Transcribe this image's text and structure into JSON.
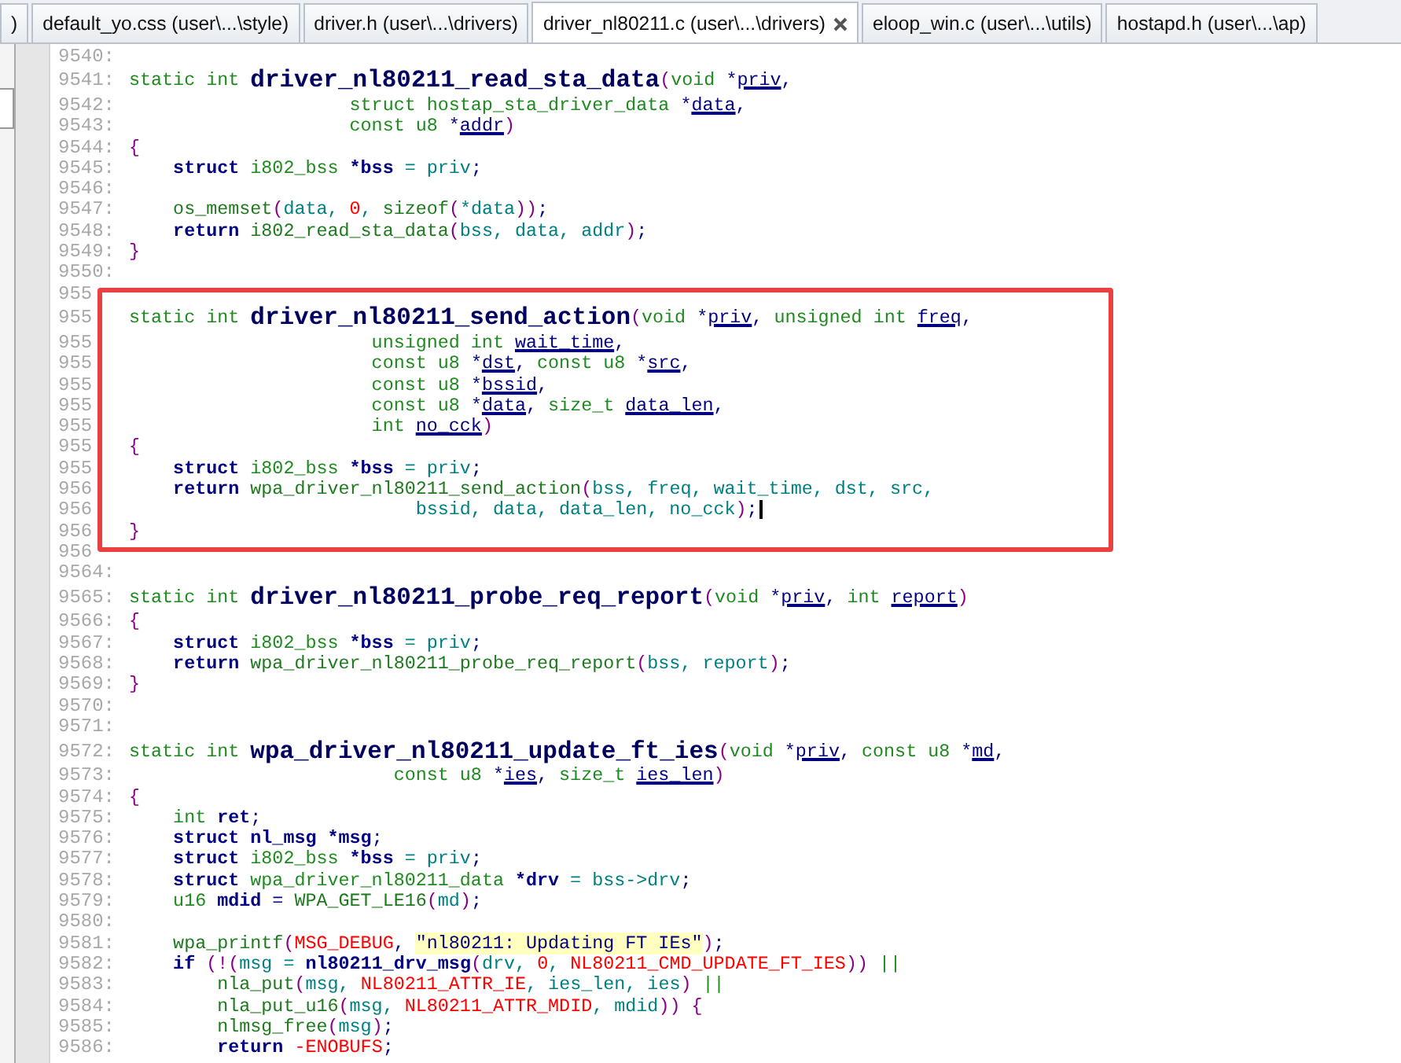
{
  "tabs": [
    {
      "label": ")",
      "selected": false
    },
    {
      "label": "default_yo.css (user\\...\\style)",
      "selected": false
    },
    {
      "label": "driver.h (user\\...\\drivers)",
      "selected": false
    },
    {
      "label": "driver_nl80211.c (user\\...\\drivers)",
      "selected": true
    },
    {
      "label": "eloop_win.c (user\\...\\utils)",
      "selected": false
    },
    {
      "label": "hostapd.h (user\\...\\ap)",
      "selected": false
    }
  ],
  "editor": {
    "lines": [
      {
        "number": "9540:",
        "cursor": false
      },
      {
        "number": "9541:",
        "cursor": false,
        "tokens": [
          {
            "kind": "type",
            "text": "static int "
          },
          {
            "kind": "funcname",
            "text": "driver_nl80211_read_sta_data"
          },
          {
            "kind": "paren",
            "text": "("
          },
          {
            "kind": "type",
            "text": "void "
          },
          {
            "kind": "punct",
            "text": "*"
          },
          {
            "kind": "param",
            "text": "priv"
          },
          {
            "kind": "punct",
            "text": ","
          }
        ]
      },
      {
        "number": "9542:",
        "cursor": false,
        "tokens": [
          {
            "kind": "type",
            "text": "                    struct hostap_sta_driver_data "
          },
          {
            "kind": "punct",
            "text": "*"
          },
          {
            "kind": "param",
            "text": "data"
          },
          {
            "kind": "punct",
            "text": ","
          }
        ]
      },
      {
        "number": "9543:",
        "cursor": false,
        "tokens": [
          {
            "kind": "type",
            "text": "                    const u8 "
          },
          {
            "kind": "punct",
            "text": "*"
          },
          {
            "kind": "param",
            "text": "addr"
          },
          {
            "kind": "paren",
            "text": ")"
          }
        ]
      },
      {
        "number": "9544:",
        "cursor": false,
        "tokens": [
          {
            "kind": "paren",
            "text": "{"
          }
        ]
      },
      {
        "number": "9545:",
        "cursor": false,
        "tokens": [
          {
            "kind": "keyword",
            "text": "    struct "
          },
          {
            "kind": "type",
            "text": "i802_bss "
          },
          {
            "kind": "keyword",
            "text": "*bss"
          },
          {
            "kind": "ident",
            "text": " = priv"
          },
          {
            "kind": "punct",
            "text": ";"
          }
        ]
      },
      {
        "number": "9546:",
        "cursor": false
      },
      {
        "number": "9547:",
        "cursor": false,
        "tokens": [
          {
            "kind": "call",
            "text": "    os_memset"
          },
          {
            "kind": "paren",
            "text": "("
          },
          {
            "kind": "ident",
            "text": "data, "
          },
          {
            "kind": "literal",
            "text": "0"
          },
          {
            "kind": "ident",
            "text": ", "
          },
          {
            "kind": "call",
            "text": "sizeof"
          },
          {
            "kind": "paren",
            "text": "("
          },
          {
            "kind": "ident",
            "text": "*data"
          },
          {
            "kind": "paren",
            "text": "))"
          },
          {
            "kind": "punct",
            "text": ";"
          }
        ]
      },
      {
        "number": "9548:",
        "cursor": false,
        "tokens": [
          {
            "kind": "keyword",
            "text": "    return "
          },
          {
            "kind": "call",
            "text": "i802_read_sta_data"
          },
          {
            "kind": "paren",
            "text": "("
          },
          {
            "kind": "ident",
            "text": "bss, data, addr"
          },
          {
            "kind": "paren",
            "text": ")"
          },
          {
            "kind": "punct",
            "text": ";"
          }
        ]
      },
      {
        "number": "9549:",
        "cursor": false,
        "tokens": [
          {
            "kind": "paren",
            "text": "}"
          }
        ]
      },
      {
        "number": "9550:",
        "cursor": false
      },
      {
        "number": "955",
        "cursor": false
      },
      {
        "number": "955",
        "cursor": false,
        "tokens": [
          {
            "kind": "type",
            "text": "static int "
          },
          {
            "kind": "funcname",
            "text": "driver_nl80211_send_action"
          },
          {
            "kind": "paren",
            "text": "("
          },
          {
            "kind": "type",
            "text": "void "
          },
          {
            "kind": "punct",
            "text": "*"
          },
          {
            "kind": "param",
            "text": "priv"
          },
          {
            "kind": "punct",
            "text": ", "
          },
          {
            "kind": "type",
            "text": "unsigned int "
          },
          {
            "kind": "param",
            "text": "freq"
          },
          {
            "kind": "punct",
            "text": ","
          }
        ]
      },
      {
        "number": "955",
        "cursor": false,
        "tokens": [
          {
            "kind": "type",
            "text": "                      unsigned int "
          },
          {
            "kind": "param",
            "text": "wait_time"
          },
          {
            "kind": "punct",
            "text": ","
          }
        ]
      },
      {
        "number": "955",
        "cursor": false,
        "tokens": [
          {
            "kind": "type",
            "text": "                      const u8 "
          },
          {
            "kind": "punct",
            "text": "*"
          },
          {
            "kind": "param",
            "text": "dst"
          },
          {
            "kind": "punct",
            "text": ", "
          },
          {
            "kind": "type",
            "text": "const u8 "
          },
          {
            "kind": "punct",
            "text": "*"
          },
          {
            "kind": "param",
            "text": "src"
          },
          {
            "kind": "punct",
            "text": ","
          }
        ]
      },
      {
        "number": "955",
        "cursor": false,
        "tokens": [
          {
            "kind": "type",
            "text": "                      const u8 "
          },
          {
            "kind": "punct",
            "text": "*"
          },
          {
            "kind": "param",
            "text": "bssid"
          },
          {
            "kind": "punct",
            "text": ","
          }
        ]
      },
      {
        "number": "955",
        "cursor": false,
        "tokens": [
          {
            "kind": "type",
            "text": "                      const u8 "
          },
          {
            "kind": "punct",
            "text": "*"
          },
          {
            "kind": "param",
            "text": "data"
          },
          {
            "kind": "punct",
            "text": ", "
          },
          {
            "kind": "type",
            "text": "size_t "
          },
          {
            "kind": "param",
            "text": "data_len"
          },
          {
            "kind": "punct",
            "text": ","
          }
        ]
      },
      {
        "number": "955",
        "cursor": false,
        "tokens": [
          {
            "kind": "type",
            "text": "                      int "
          },
          {
            "kind": "param",
            "text": "no_cck"
          },
          {
            "kind": "paren",
            "text": ")"
          }
        ]
      },
      {
        "number": "955",
        "cursor": false,
        "tokens": [
          {
            "kind": "paren",
            "text": "{"
          }
        ]
      },
      {
        "number": "955",
        "cursor": false,
        "tokens": [
          {
            "kind": "keyword",
            "text": "    struct "
          },
          {
            "kind": "type",
            "text": "i802_bss "
          },
          {
            "kind": "keyword",
            "text": "*bss"
          },
          {
            "kind": "ident",
            "text": " = priv"
          },
          {
            "kind": "punct",
            "text": ";"
          }
        ]
      },
      {
        "number": "956",
        "cursor": false,
        "tokens": [
          {
            "kind": "keyword",
            "text": "    return "
          },
          {
            "kind": "call",
            "text": "wpa_driver_nl80211_send_action"
          },
          {
            "kind": "paren",
            "text": "("
          },
          {
            "kind": "ident",
            "text": "bss, freq, wait_time, dst, src,"
          }
        ]
      },
      {
        "number": "956",
        "cursor": true,
        "tokens": [
          {
            "kind": "ident",
            "text": "                          bssid, data, data_len, no_cck"
          },
          {
            "kind": "paren",
            "text": ")"
          },
          {
            "kind": "punct",
            "text": ";"
          }
        ]
      },
      {
        "number": "956",
        "cursor": false,
        "tokens": [
          {
            "kind": "paren",
            "text": "}"
          }
        ]
      },
      {
        "number": "956",
        "cursor": false
      },
      {
        "number": "9564:",
        "cursor": false
      },
      {
        "number": "9565:",
        "cursor": false,
        "tokens": [
          {
            "kind": "type",
            "text": "static int "
          },
          {
            "kind": "funcname",
            "text": "driver_nl80211_probe_req_report"
          },
          {
            "kind": "paren",
            "text": "("
          },
          {
            "kind": "type",
            "text": "void "
          },
          {
            "kind": "punct",
            "text": "*"
          },
          {
            "kind": "param",
            "text": "priv"
          },
          {
            "kind": "punct",
            "text": ", "
          },
          {
            "kind": "type",
            "text": "int "
          },
          {
            "kind": "param",
            "text": "report"
          },
          {
            "kind": "paren",
            "text": ")"
          }
        ]
      },
      {
        "number": "9566:",
        "cursor": false,
        "tokens": [
          {
            "kind": "paren",
            "text": "{"
          }
        ]
      },
      {
        "number": "9567:",
        "cursor": false,
        "tokens": [
          {
            "kind": "keyword",
            "text": "    struct "
          },
          {
            "kind": "type",
            "text": "i802_bss "
          },
          {
            "kind": "keyword",
            "text": "*bss"
          },
          {
            "kind": "ident",
            "text": " = priv"
          },
          {
            "kind": "punct",
            "text": ";"
          }
        ]
      },
      {
        "number": "9568:",
        "cursor": false,
        "tokens": [
          {
            "kind": "keyword",
            "text": "    return "
          },
          {
            "kind": "call",
            "text": "wpa_driver_nl80211_probe_req_report"
          },
          {
            "kind": "paren",
            "text": "("
          },
          {
            "kind": "ident",
            "text": "bss, report"
          },
          {
            "kind": "paren",
            "text": ")"
          },
          {
            "kind": "punct",
            "text": ";"
          }
        ]
      },
      {
        "number": "9569:",
        "cursor": false,
        "tokens": [
          {
            "kind": "paren",
            "text": "}"
          }
        ]
      },
      {
        "number": "9570:",
        "cursor": false
      },
      {
        "number": "9571:",
        "cursor": false
      },
      {
        "number": "9572:",
        "cursor": false,
        "tokens": [
          {
            "kind": "type",
            "text": "static int "
          },
          {
            "kind": "funcname",
            "text": "wpa_driver_nl80211_update_ft_ies"
          },
          {
            "kind": "paren",
            "text": "("
          },
          {
            "kind": "type",
            "text": "void "
          },
          {
            "kind": "punct",
            "text": "*"
          },
          {
            "kind": "param",
            "text": "priv"
          },
          {
            "kind": "punct",
            "text": ", "
          },
          {
            "kind": "type",
            "text": "const u8 "
          },
          {
            "kind": "punct",
            "text": "*"
          },
          {
            "kind": "param",
            "text": "md"
          },
          {
            "kind": "punct",
            "text": ","
          }
        ]
      },
      {
        "number": "9573:",
        "cursor": false,
        "tokens": [
          {
            "kind": "type",
            "text": "                        const u8 "
          },
          {
            "kind": "punct",
            "text": "*"
          },
          {
            "kind": "param",
            "text": "ies"
          },
          {
            "kind": "punct",
            "text": ", "
          },
          {
            "kind": "type",
            "text": "size_t "
          },
          {
            "kind": "param",
            "text": "ies_len"
          },
          {
            "kind": "paren",
            "text": ")"
          }
        ]
      },
      {
        "number": "9574:",
        "cursor": false,
        "tokens": [
          {
            "kind": "paren",
            "text": "{"
          }
        ]
      },
      {
        "number": "9575:",
        "cursor": false,
        "tokens": [
          {
            "kind": "type",
            "text": "    int "
          },
          {
            "kind": "keyword",
            "text": "ret"
          },
          {
            "kind": "punct",
            "text": ";"
          }
        ]
      },
      {
        "number": "9576:",
        "cursor": false,
        "tokens": [
          {
            "kind": "keyword",
            "text": "    struct nl_msg *msg"
          },
          {
            "kind": "punct",
            "text": ";"
          }
        ]
      },
      {
        "number": "9577:",
        "cursor": false,
        "tokens": [
          {
            "kind": "keyword",
            "text": "    struct "
          },
          {
            "kind": "type",
            "text": "i802_bss "
          },
          {
            "kind": "keyword",
            "text": "*bss"
          },
          {
            "kind": "ident",
            "text": " = priv"
          },
          {
            "kind": "punct",
            "text": ";"
          }
        ]
      },
      {
        "number": "9578:",
        "cursor": false,
        "tokens": [
          {
            "kind": "keyword",
            "text": "    struct "
          },
          {
            "kind": "type",
            "text": "wpa_driver_nl80211_data "
          },
          {
            "kind": "keyword",
            "text": "*drv"
          },
          {
            "kind": "ident",
            "text": " = bss->drv"
          },
          {
            "kind": "punct",
            "text": ";"
          }
        ]
      },
      {
        "number": "9579:",
        "cursor": false,
        "tokens": [
          {
            "kind": "type",
            "text": "    u16 "
          },
          {
            "kind": "keyword",
            "text": "mdid"
          },
          {
            "kind": "punct",
            "text": " = "
          },
          {
            "kind": "call",
            "text": "WPA_GET_LE16"
          },
          {
            "kind": "paren",
            "text": "("
          },
          {
            "kind": "ident",
            "text": "md"
          },
          {
            "kind": "paren",
            "text": ")"
          },
          {
            "kind": "punct",
            "text": ";"
          }
        ]
      },
      {
        "number": "9580:",
        "cursor": false
      },
      {
        "number": "9581:",
        "cursor": false,
        "tokens": [
          {
            "kind": "call",
            "text": "    wpa_printf"
          },
          {
            "kind": "paren",
            "text": "("
          },
          {
            "kind": "literal",
            "text": "MSG_DEBUG"
          },
          {
            "kind": "punct",
            "text": ", "
          },
          {
            "kind": "string",
            "text": "\"nl80211: Updating FT IEs\""
          },
          {
            "kind": "paren",
            "text": ")"
          },
          {
            "kind": "punct",
            "text": ";"
          }
        ]
      },
      {
        "number": "9582:",
        "cursor": false,
        "tokens": [
          {
            "kind": "keyword",
            "text": "    if "
          },
          {
            "kind": "paren",
            "text": "(!("
          },
          {
            "kind": "ident",
            "text": "msg = "
          },
          {
            "kind": "keyword",
            "text": "nl80211_drv_msg"
          },
          {
            "kind": "paren",
            "text": "("
          },
          {
            "kind": "ident",
            "text": "drv, "
          },
          {
            "kind": "literal",
            "text": "0"
          },
          {
            "kind": "ident",
            "text": ", "
          },
          {
            "kind": "literal",
            "text": "NL80211_CMD_UPDATE_FT_IES"
          },
          {
            "kind": "paren",
            "text": "))"
          },
          {
            "kind": "type",
            "text": " ||"
          }
        ]
      },
      {
        "number": "9583:",
        "cursor": false,
        "tokens": [
          {
            "kind": "call",
            "text": "        nla_put"
          },
          {
            "kind": "paren",
            "text": "("
          },
          {
            "kind": "ident",
            "text": "msg, "
          },
          {
            "kind": "literal",
            "text": "NL80211_ATTR_IE"
          },
          {
            "kind": "ident",
            "text": ", ies_len, ies"
          },
          {
            "kind": "paren",
            "text": ")"
          },
          {
            "kind": "type",
            "text": " ||"
          }
        ]
      },
      {
        "number": "9584:",
        "cursor": false,
        "tokens": [
          {
            "kind": "call",
            "text": "        nla_put_u16"
          },
          {
            "kind": "paren",
            "text": "("
          },
          {
            "kind": "ident",
            "text": "msg, "
          },
          {
            "kind": "literal",
            "text": "NL80211_ATTR_MDID"
          },
          {
            "kind": "ident",
            "text": ", mdid"
          },
          {
            "kind": "paren",
            "text": ")) {"
          }
        ]
      },
      {
        "number": "9585:",
        "cursor": false,
        "tokens": [
          {
            "kind": "call",
            "text": "        nlmsg_free"
          },
          {
            "kind": "paren",
            "text": "("
          },
          {
            "kind": "ident",
            "text": "msg"
          },
          {
            "kind": "paren",
            "text": ")"
          },
          {
            "kind": "punct",
            "text": ";"
          }
        ]
      },
      {
        "number": "9586:",
        "cursor": false,
        "tokens": [
          {
            "kind": "keyword",
            "text": "        return "
          },
          {
            "kind": "literal",
            "text": "-ENOBUFS"
          },
          {
            "kind": "punct",
            "text": ";"
          }
        ]
      }
    ]
  }
}
